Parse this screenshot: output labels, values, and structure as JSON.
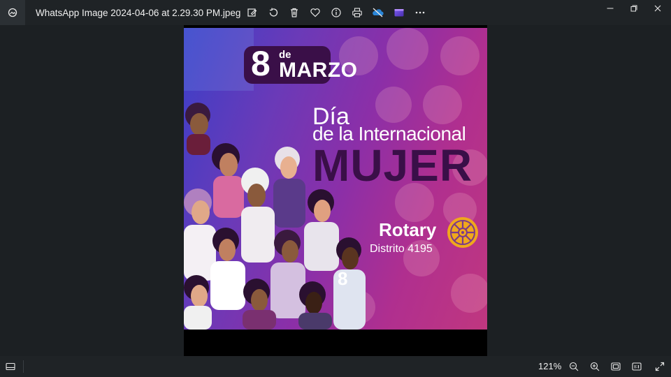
{
  "titlebar": {
    "file_name": "WhatsApp Image 2024-04-06 at 2.29.30 PM.jpeg"
  },
  "toolbar": {
    "icons": [
      "edit-image-icon",
      "rotate-icon",
      "delete-icon",
      "favorite-icon",
      "info-icon",
      "print-icon",
      "onedrive-icon",
      "clipchamp-icon",
      "more-icon"
    ]
  },
  "window_controls": [
    "minimize",
    "restore",
    "close"
  ],
  "photo": {
    "date_number": "8",
    "date_de": "de",
    "date_month": "MARZO",
    "title_line1": "Día",
    "title_line2": "de la Internacional",
    "title_line3": "MUJER",
    "org_name": "Rotary",
    "org_district": "Distrito 4195",
    "jersey_number": "8"
  },
  "statusbar": {
    "zoom_level": "121%"
  },
  "colors": {
    "background": "#1c2023",
    "poster_left": "#3b3fc8",
    "poster_right": "#c0377f",
    "pill": "#3a0f48",
    "rotary_gold": "#f0a81c"
  }
}
